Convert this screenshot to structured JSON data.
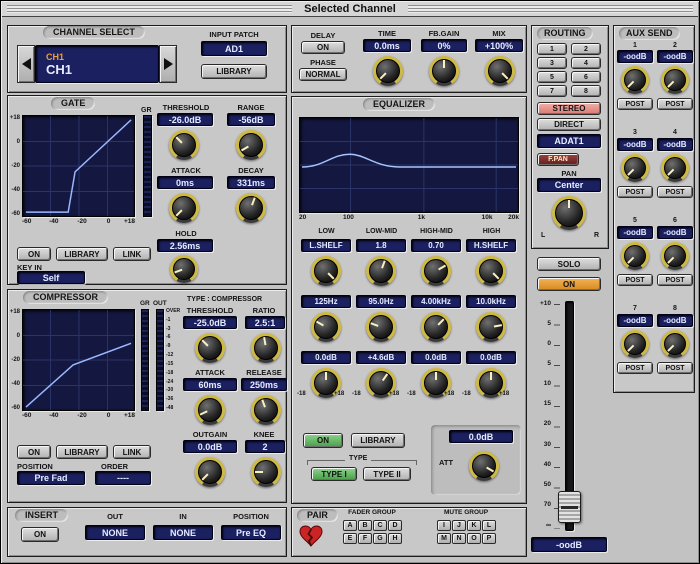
{
  "window": {
    "title": "Selected Channel"
  },
  "channel_select": {
    "title": "CHANNEL SELECT",
    "channel_id": "CH1",
    "channel_name": "CH1",
    "input_patch_label": "INPUT PATCH",
    "input_patch": "AD1",
    "library": "LIBRARY"
  },
  "gate": {
    "title": "GATE",
    "gr_label": "GR",
    "graph": {
      "x_labels": [
        "-60",
        "-40",
        "-20",
        "0",
        "+18"
      ],
      "y_labels": [
        "+18",
        "0",
        "-20",
        "-40",
        "-60"
      ]
    },
    "threshold_label": "THRESHOLD",
    "threshold": "-26.0dB",
    "range_label": "RANGE",
    "range": "-56dB",
    "attack_label": "ATTACK",
    "attack": "0ms",
    "decay_label": "DECAY",
    "decay": "331ms",
    "hold_label": "HOLD",
    "hold": "2.56ms",
    "on": "ON",
    "library": "LIBRARY",
    "link": "LINK",
    "key_in_label": "KEY IN",
    "key_in": "Self"
  },
  "compressor": {
    "title": "COMPRESSOR",
    "type_label": "TYPE : COMPRESSOR",
    "gr_label": "GR",
    "out_label": "OUT",
    "meter_scale": [
      "OVER",
      "-1",
      "-3",
      "-6",
      "-9",
      "-12",
      "-15",
      "-18",
      "-24",
      "-30",
      "-36",
      "-48"
    ],
    "graph": {
      "x_labels": [
        "-60",
        "-40",
        "-20",
        "0",
        "+18"
      ],
      "y_labels": [
        "+18",
        "0",
        "-20",
        "-40",
        "-60"
      ]
    },
    "threshold_label": "THRESHOLD",
    "threshold": "-25.0dB",
    "ratio_label": "RATIO",
    "ratio": "2.5:1",
    "attack_label": "ATTACK",
    "attack": "60ms",
    "release_label": "RELEASE",
    "release": "250ms",
    "outgain_label": "OUTGAIN",
    "outgain": "0.0dB",
    "knee_label": "KNEE",
    "knee": "2",
    "on": "ON",
    "library": "LIBRARY",
    "link": "LINK",
    "position_label": "POSITION",
    "position": "Pre Fad",
    "order_label": "ORDER",
    "order": "----"
  },
  "insert": {
    "title": "INSERT",
    "on": "ON",
    "out_label": "OUT",
    "out": "NONE",
    "in_label": "IN",
    "in": "NONE",
    "position_label": "POSITION",
    "position": "Pre EQ"
  },
  "delay": {
    "title": "DELAY",
    "on": "ON",
    "phase_label": "PHASE",
    "phase": "NORMAL",
    "time_label": "TIME",
    "time": "0.0ms",
    "fbgain_label": "FB.GAIN",
    "fbgain": "0%",
    "mix_label": "MIX",
    "mix": "+100%"
  },
  "equalizer": {
    "title": "EQUALIZER",
    "freq_labels": [
      "20",
      "100",
      "1k",
      "10k",
      "20k"
    ],
    "bands": [
      {
        "name": "LOW",
        "q": "L.SHELF",
        "f": "125Hz",
        "g": "0.0dB"
      },
      {
        "name": "LOW-MID",
        "q": "1.8",
        "f": "95.0Hz",
        "g": "+4.6dB"
      },
      {
        "name": "HIGH-MID",
        "q": "0.70",
        "f": "4.00kHz",
        "g": "0.0dB"
      },
      {
        "name": "HIGH",
        "q": "H.SHELF",
        "f": "10.0kHz",
        "g": "0.0dB"
      }
    ],
    "gain_min": "-18",
    "gain_max": "+18",
    "on": "ON",
    "library": "LIBRARY",
    "type_label": "TYPE",
    "type1": "TYPE I",
    "type2": "TYPE II",
    "att_label": "ATT",
    "att": "0.0dB"
  },
  "pair": {
    "title": "PAIR",
    "fader_group_label": "FADER GROUP",
    "fader_groups": [
      "A",
      "B",
      "C",
      "D",
      "E",
      "F",
      "G",
      "H"
    ],
    "mute_group_label": "MUTE GROUP",
    "mute_groups": [
      "I",
      "J",
      "K",
      "L",
      "M",
      "N",
      "O",
      "P"
    ]
  },
  "routing": {
    "title": "ROUTING",
    "buses": [
      "1",
      "2",
      "3",
      "4",
      "5",
      "6",
      "7",
      "8"
    ],
    "stereo": "STEREO",
    "direct": "DIRECT",
    "direct_dest": "ADAT1",
    "fpan": "F.PAN",
    "pan_label": "PAN",
    "pan": "Center",
    "left": "L",
    "right": "R"
  },
  "channel": {
    "solo": "SOLO",
    "on": "ON",
    "fader_scale": [
      "+10",
      "5",
      "0",
      "5",
      "10",
      "15",
      "20",
      "30",
      "40",
      "50",
      "70",
      "∞"
    ],
    "fader_value": "-oodB"
  },
  "aux": {
    "title": "AUX SEND",
    "post": "POST",
    "sends": [
      {
        "num": "1",
        "value": "-oodB"
      },
      {
        "num": "2",
        "value": "-oodB"
      },
      {
        "num": "3",
        "value": "-oodB"
      },
      {
        "num": "4",
        "value": "-oodB"
      },
      {
        "num": "5",
        "value": "-oodB"
      },
      {
        "num": "6",
        "value": "-oodB"
      },
      {
        "num": "7",
        "value": "-oodB"
      },
      {
        "num": "8",
        "value": "-oodB"
      }
    ]
  }
}
